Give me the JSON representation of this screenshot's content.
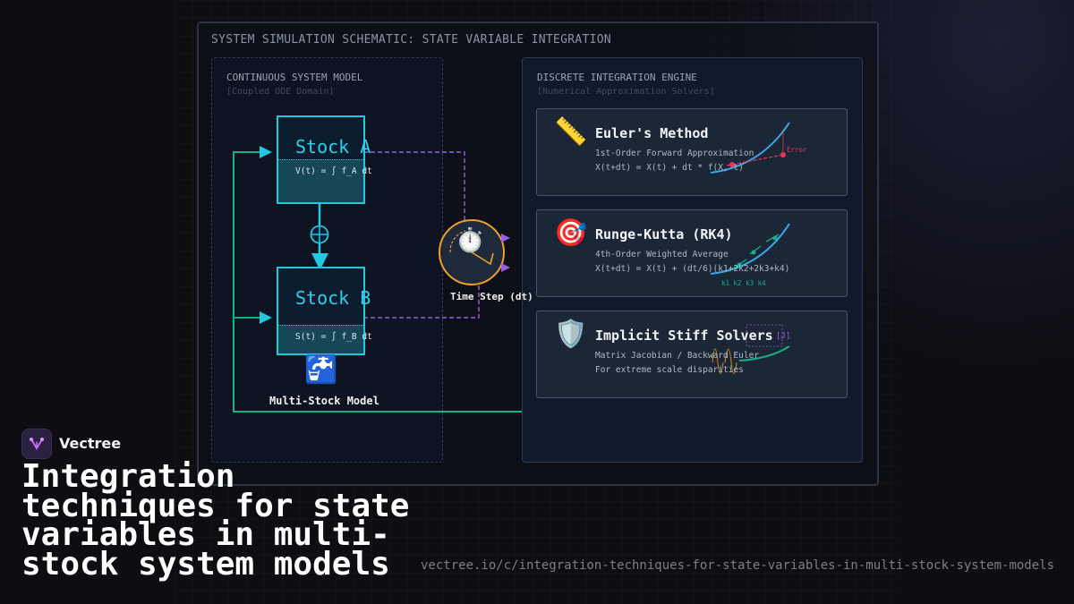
{
  "schematic": {
    "title": "SYSTEM SIMULATION SCHEMATIC: STATE VARIABLE INTEGRATION",
    "continuous_panel": {
      "title": "CONTINUOUS SYSTEM MODEL",
      "subtitle": "[Coupled ODE Domain]",
      "stock_a": {
        "name": "Stock A",
        "equation": "V(t) = ∫ f_A dt"
      },
      "stock_b": {
        "name": "Stock B",
        "equation": "S(t) = ∫ f_B dt"
      },
      "model_icon": "faucet-icon",
      "model_label": "Multi-Stock Model"
    },
    "timestep": {
      "icon": "stopwatch-icon",
      "label": "Time Step (dt)"
    },
    "discrete_panel": {
      "title": "DISCRETE INTEGRATION ENGINE",
      "subtitle": "[Numerical Approximation Solvers]",
      "methods": [
        {
          "icon": "ruler-icon",
          "title": "Euler's Method",
          "line1": "1st-Order Forward Approximation",
          "line2": "X(t+dt) = X(t) + dt * f(X, t)",
          "graph_label": "Error"
        },
        {
          "icon": "target-icon",
          "title": "Runge-Kutta (RK4)",
          "line1": "4th-Order Weighted Average",
          "line2": "X(t+dt) = X(t) + (dt/6)(k1+2k2+2k3+k4)",
          "graph_label": "k1 k2 k3 k4"
        },
        {
          "icon": "shield-icon",
          "title": "Implicit Stiff Solvers",
          "line1": "Matrix Jacobian / Backward Euler",
          "line2": "For extreme scale disparities",
          "graph_label": "[J]"
        }
      ]
    }
  },
  "colors": {
    "stock_border": "#22c7e0",
    "feedback_line": "#15b088",
    "dashed_link": "#9b5de5",
    "timestep_ring": "#f0a020",
    "error_marker": "#e8345a"
  },
  "brand": {
    "name": "Vectree",
    "logo_icon": "vectree-logo-icon"
  },
  "headline": "Integration techniques for state variables in multi-stock system models",
  "url": "vectree.io/c/integration-techniques-for-state-variables-in-multi-stock-system-models"
}
